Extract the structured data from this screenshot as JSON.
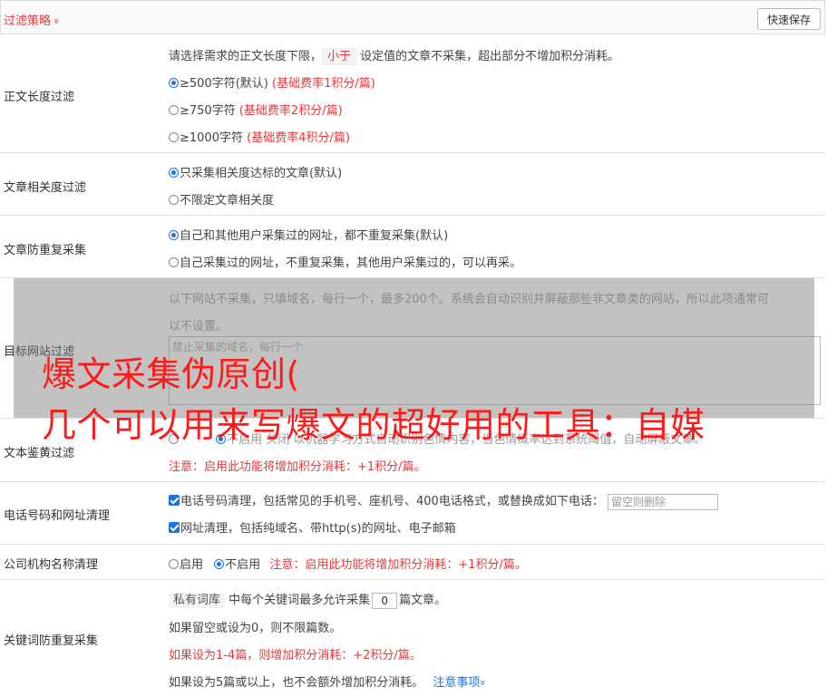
{
  "header": {
    "title": "过滤策略",
    "chevron": "»",
    "save_label": "快速保存"
  },
  "length_filter": {
    "label": "正文长度过滤",
    "desc_prefix": "请选择需求的正文长度下限，",
    "desc_tag": "小于",
    "desc_suffix": "设定值的文章不采集，超出部分不增加积分消耗。",
    "options": [
      {
        "text": "≥500字符(默认)",
        "note": "(基础费率1积分/篇)",
        "selected": true
      },
      {
        "text": "≥750字符",
        "note": "(基础费率2积分/篇)",
        "selected": false
      },
      {
        "text": "≥1000字符",
        "note": "(基础费率4积分/篇)",
        "selected": false
      }
    ]
  },
  "relevance_filter": {
    "label": "文章相关度过滤",
    "options": [
      {
        "text": "只采集相关度达标的文章(默认)",
        "selected": true
      },
      {
        "text": "不限定文章相关度",
        "selected": false
      }
    ]
  },
  "dedupe": {
    "label": "文章防重复采集",
    "options": [
      {
        "text": "自己和其他用户采集过的网址，都不重复采集(默认)",
        "selected": true
      },
      {
        "text": "自己采集过的网址，不重复采集，其他用户采集过的，可以再采。",
        "selected": false
      }
    ]
  },
  "site_filter": {
    "label": "目标网站过滤",
    "desc_line1": "以下网站不采集，只填域名，每行一个，最多200个。系统会自动识别并屏蔽那些非文章类的网站，所以此项通常可",
    "desc_line2": "以不设置。",
    "placeholder": "禁止采集的域名，每行一个"
  },
  "porn_filter": {
    "label": "文本鉴黄过滤",
    "line": "不启用   关闭  以机器学习方式自动识别色情内容，当色情概率达到系统阈值，自动屏蔽文章。",
    "note": "注意：启用此功能将增加积分消耗：+1积分/篇。"
  },
  "phone_clean": {
    "label": "电话号码和网址清理",
    "phone_text": "电话号码清理，包括常见的手机号、座机号、400电话格式，或替换成如下电话：",
    "phone_placeholder": "留空则删除",
    "url_text": "网址清理，包括纯域名、带http(s)的网址、电子邮箱"
  },
  "company_clean": {
    "label": "公司机构名称清理",
    "on_text": "启用",
    "off_text": "不启用",
    "note": "注意：启用此功能将增加积分消耗：+1积分/篇。"
  },
  "keyword_dedupe": {
    "label": "关键词防重复采集",
    "tag": "私有词库",
    "prefix": "中每个关键词最多允许采集",
    "value": "0",
    "suffix": "篇文章。",
    "line2": "如果留空或设为0，则不限篇数。",
    "line3": "如果设为1-4篇，则增加积分消耗：+2积分/篇。",
    "line4": "如果设为5篇或以上，也不会额外增加积分消耗。",
    "link": "注意事项",
    "link_chevron": "»"
  },
  "banner": {
    "line1": "爆文采集伪原创(",
    "line2": "几个可以用来写爆文的超好用的工具：自媒"
  },
  "colors": {
    "accent": "#e4393c",
    "link": "#1a73e8",
    "banner": "#ff1a1a"
  }
}
